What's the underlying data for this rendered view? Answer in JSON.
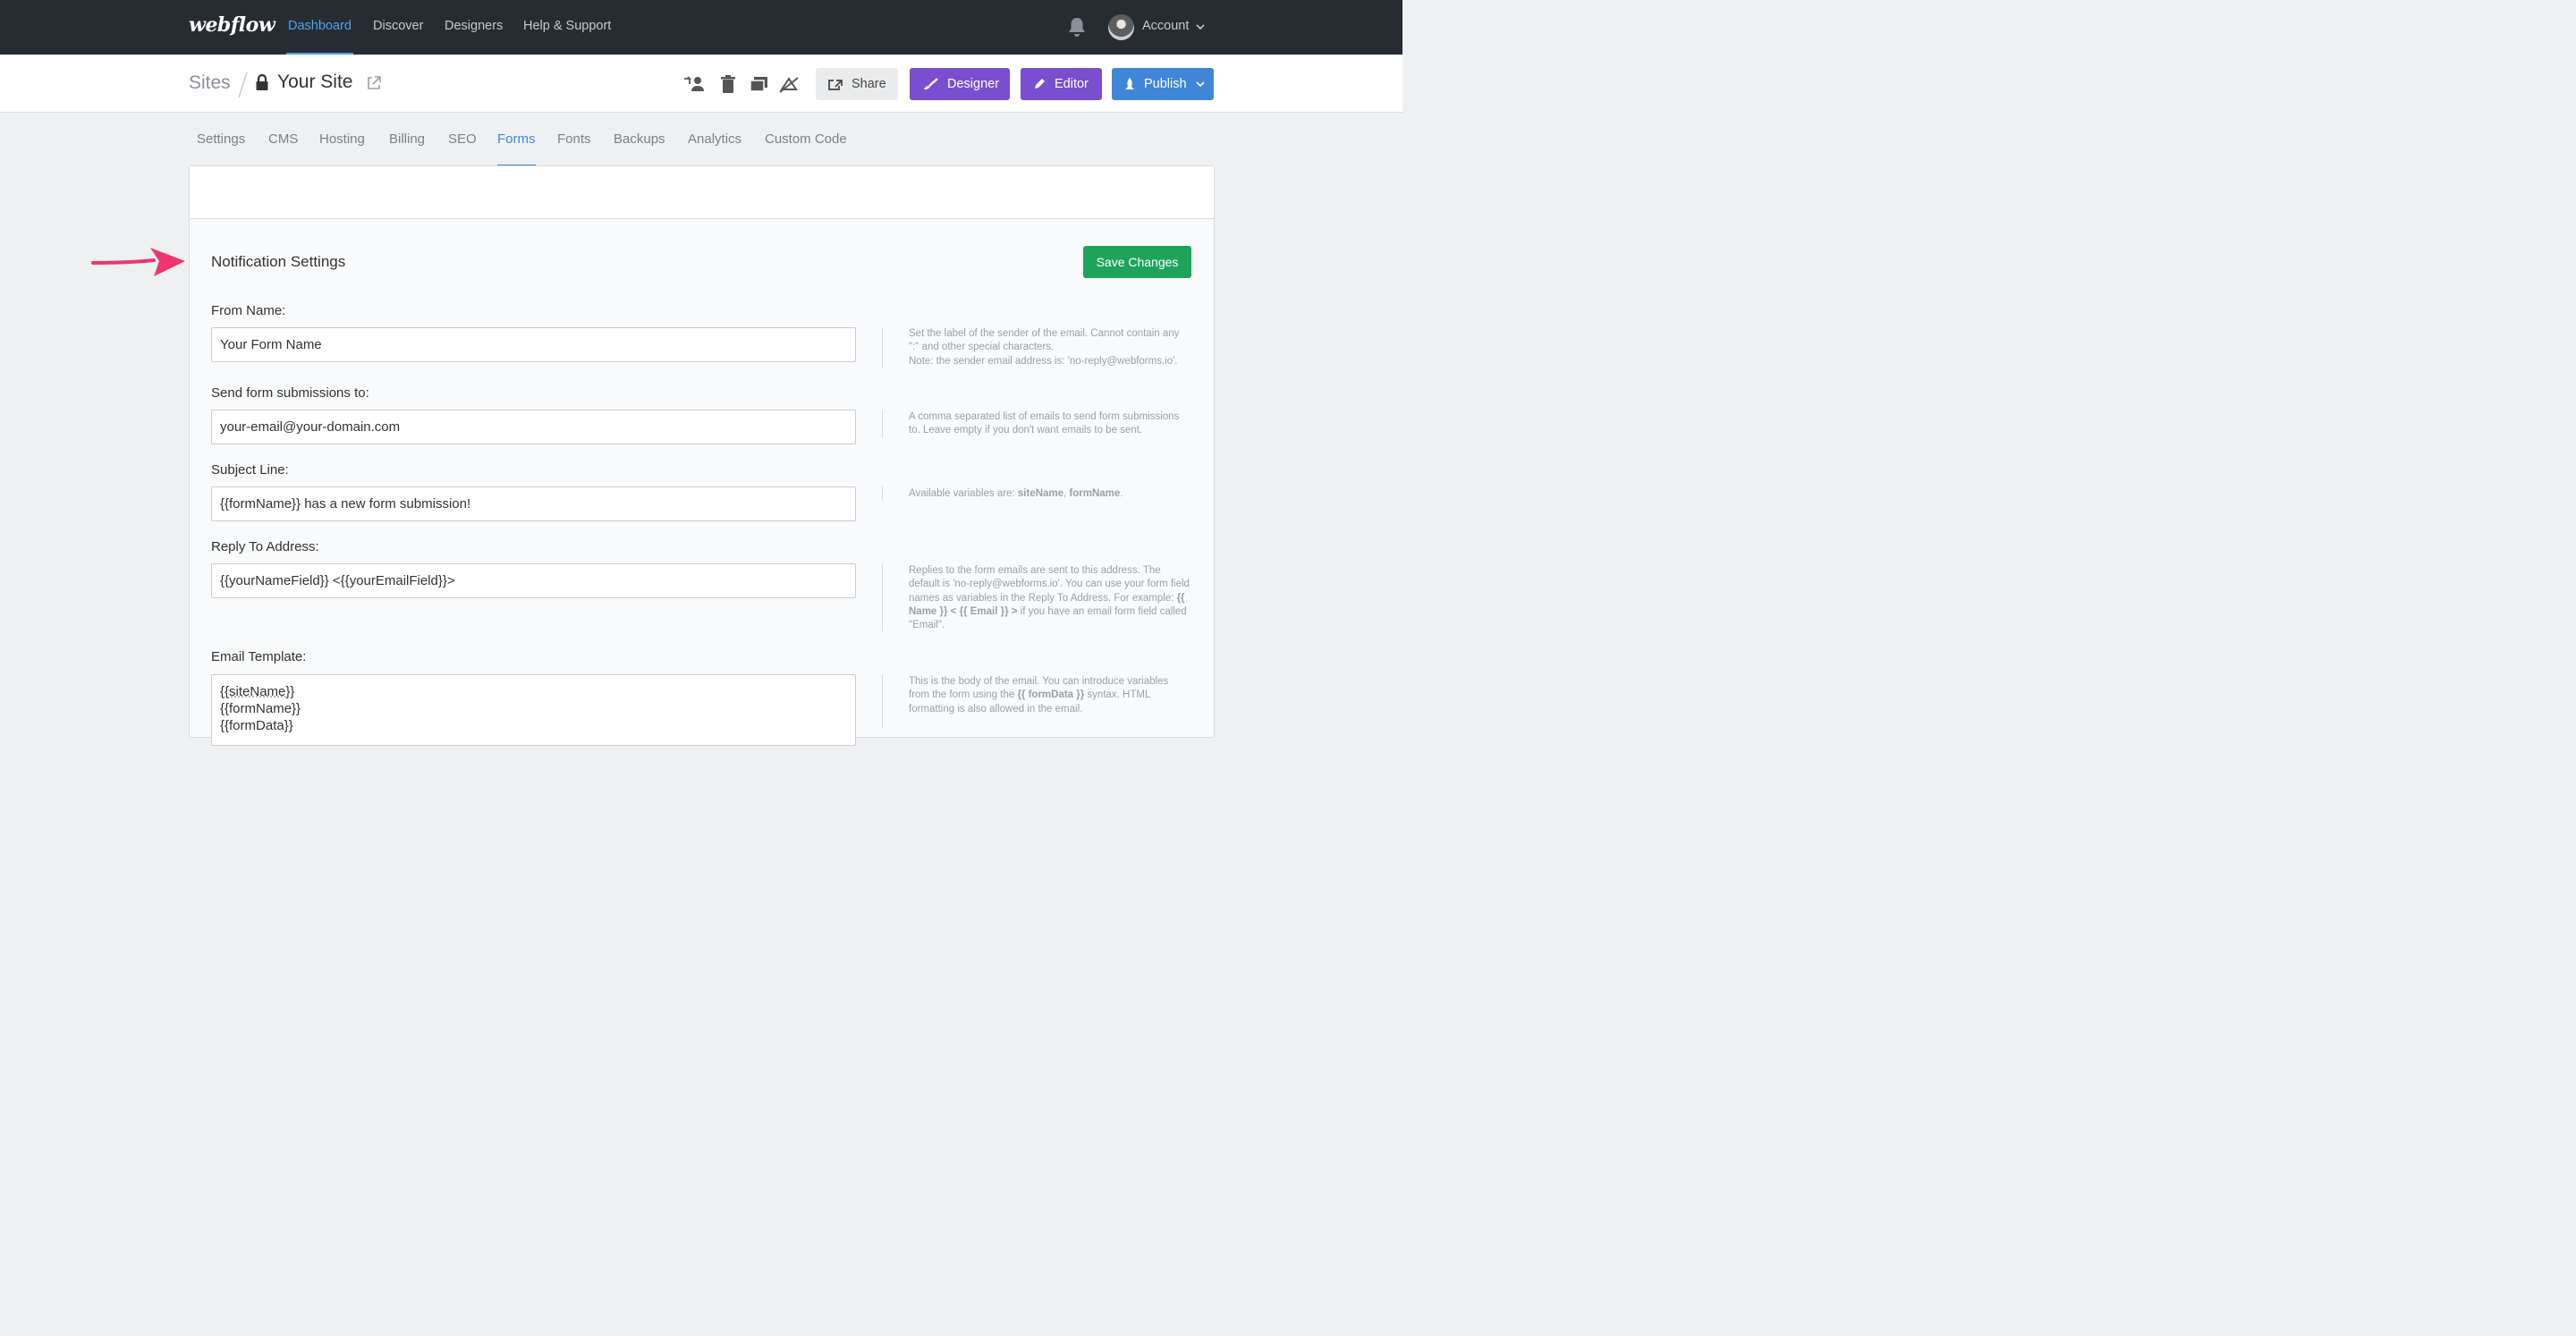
{
  "nav": {
    "logo": "webflow",
    "links": [
      "Dashboard",
      "Discover",
      "Designers",
      "Help & Support"
    ],
    "account": "Account"
  },
  "sitebar": {
    "sites": "Sites",
    "site_name": "Your Site",
    "share": "Share",
    "designer": "Designer",
    "editor": "Editor",
    "publish": "Publish"
  },
  "tabs": [
    "Settings",
    "CMS",
    "Hosting",
    "Billing",
    "SEO",
    "Forms",
    "Fonts",
    "Backups",
    "Analytics",
    "Custom Code"
  ],
  "active_tab": "Forms",
  "notification": {
    "title": "Notification Settings",
    "save": "Save Changes",
    "from_name": {
      "label": "From Name:",
      "value": "Your Form Name",
      "help1": "Set the label of the sender of the email. Cannot contain any \":\" and other special characters.",
      "help2": "Note: the sender email address is: 'no-reply@webforms.io'."
    },
    "send_to": {
      "label": "Send form submissions to:",
      "value": "your-email@your-domain.com",
      "help": "A comma separated list of emails to send form submissions to. Leave empty if you don't want emails to be sent."
    },
    "subject": {
      "label": "Subject Line:",
      "value": "{{formName}} has a new form submission!",
      "help_prefix": "Available variables are: ",
      "var1": "siteName",
      "sep": ", ",
      "var2": "formName",
      "help_suffix": "."
    },
    "reply_to": {
      "label": "Reply To Address:",
      "value": "{{yourNameField}} <{{yourEmailField}}>",
      "help_a": "Replies to the form emails are sent to this address. The default is 'no-reply@webforms.io'. You can use your form field names as variables in the Reply To Address. For example: ",
      "help_code": "{{ Name }} < {{ Email }} >",
      "help_b": " if you have an email form field called \"Email\"."
    },
    "template": {
      "label": "Email Template:",
      "lines": [
        "{{siteName}}",
        "{{formName}}",
        "{{formData}}"
      ],
      "help_a": "This is the body of the email. You can introduce variables from the form using the ",
      "help_code": "{{ formData }}",
      "help_b": " syntax. HTML formatting is also allowed in the email."
    }
  },
  "colors": {
    "nav_bg": "#272c33",
    "accent_blue": "#3f86d8",
    "purple": "#7a4fcf",
    "green": "#1ea35b",
    "arrow": "#f0346e"
  }
}
